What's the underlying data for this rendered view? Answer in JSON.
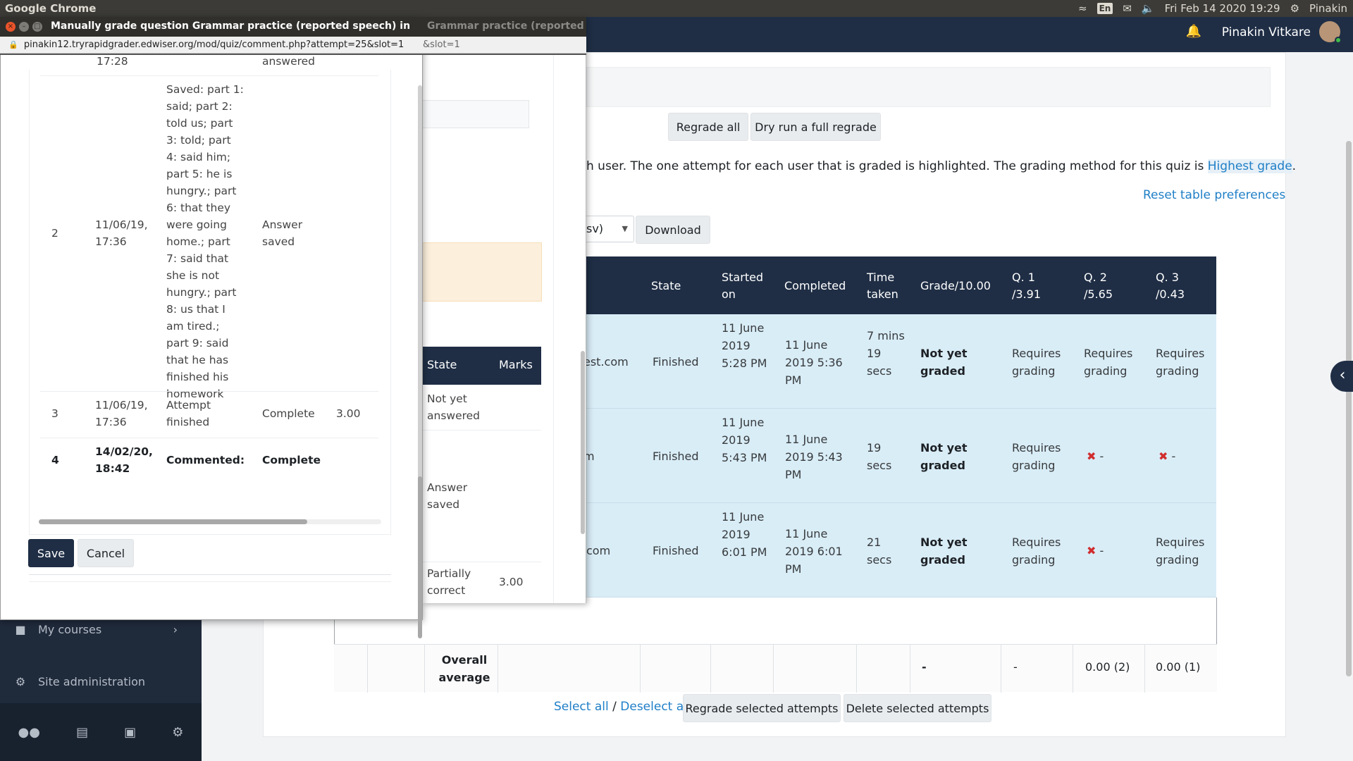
{
  "system_bar": {
    "app_name": "Google Chrome",
    "keyboard": "En",
    "datetime": "Fri Feb 14 2020 19:29",
    "user": "Pinakin"
  },
  "navbar": {
    "user_name": "Pinakin Vitkare"
  },
  "drawer": {
    "items": [
      {
        "label": "My courses",
        "icon": "briefcase-icon"
      },
      {
        "label": "Site administration",
        "icon": "gear-icon"
      }
    ],
    "bottom_icons": [
      "users-icon",
      "archive-icon",
      "file-icon",
      "cogs-icon"
    ]
  },
  "main": {
    "regrade_all": "Regrade all",
    "dry_run": "Dry run a full regrade",
    "info_text_part": "h user. The one attempt for each user that is graded is highlighted. The grading method for this quiz is",
    "grading_method": "Highest grade",
    "info_text_end": ".",
    "reset_prefs": "Reset table preferences",
    "download_select_fragment": "sv)",
    "download_button": "Download",
    "table_headers": [
      {
        "key": "state",
        "label": "State"
      },
      {
        "key": "started",
        "label": "Started on"
      },
      {
        "key": "completed",
        "label": "Completed"
      },
      {
        "key": "time",
        "label": "Time taken"
      },
      {
        "key": "grade",
        "label": "Grade/10.00"
      },
      {
        "key": "q1",
        "label": "Q. 1 /3.91"
      },
      {
        "key": "q2",
        "label": "Q. 2 /5.65"
      },
      {
        "key": "q3",
        "label": "Q. 3 /0.43"
      }
    ],
    "rows": [
      {
        "email": "est.com",
        "state": "Finished",
        "started": "11 June 2019 5:28 PM",
        "completed": "11 June 2019 5:36 PM",
        "time": "7 mins 19 secs",
        "grade": "Not yet graded",
        "q1": "Requires grading",
        "q2": "Requires grading",
        "q3": "Requires grading"
      },
      {
        "email": "m",
        "state": "Finished",
        "started": "11 June 2019 5:43 PM",
        "completed": "11 June 2019 5:43 PM",
        "time": "19 secs",
        "grade": "Not yet graded",
        "q1": "Requires grading",
        "q2": "-",
        "q3": "-"
      },
      {
        "email": "com",
        "state": "Finished",
        "started": "11 June 2019 6:01 PM",
        "completed": "11 June 2019 6:01 PM",
        "time": "21 secs",
        "grade": "Not yet graded",
        "q1": "Requires grading",
        "q2": "-",
        "q3": "Requires grading"
      }
    ],
    "overall": {
      "label": "Overall average",
      "grade": "-",
      "q1": "-",
      "q2": "0.00 (2)",
      "q3": "0.00 (1)"
    },
    "select_all": "Select all",
    "separator": "/",
    "deselect_all": "Deselect all",
    "regrade_selected": "Regrade selected attempts",
    "delete_selected": "Delete selected attempts"
  },
  "popup": {
    "title": "Manually grade question Grammar practice (reported speech) in Unit 1:",
    "title_back": "Grammar practice (reported s",
    "url": "pinakin12.tryrapidgrader.edwiser.org/mod/quiz/comment.php?attempt=25&slot=1",
    "url_back": "&slot=1",
    "top_partial": {
      "time": "17:28",
      "state": "answered"
    },
    "history": [
      {
        "step": "2",
        "time": "11/06/19, 17:36",
        "action": "Saved: part 1: said; part 2: told us; part 3: told; part 4: said him; part 5: he is hungry.; part 6: that they were going home.; part 7: said that she is not hungry.; part 8: us that I am tired.; part 9: said that he has finished his homework",
        "state": "Answer saved",
        "marks": ""
      },
      {
        "step": "3",
        "time": "11/06/19, 17:36",
        "action": "Attempt finished",
        "state": "Complete",
        "marks": "3.00"
      },
      {
        "step": "4",
        "time": "14/02/20, 18:42",
        "action": "Commented:",
        "state": "Complete",
        "marks": ""
      }
    ],
    "save": "Save",
    "cancel": "Cancel",
    "back_table": {
      "header_state": "State",
      "header_marks": "Marks",
      "r1": "Not yet answered",
      "r2": "Answer saved",
      "r3": "Partially correct",
      "r3_marks": "3.00"
    }
  }
}
